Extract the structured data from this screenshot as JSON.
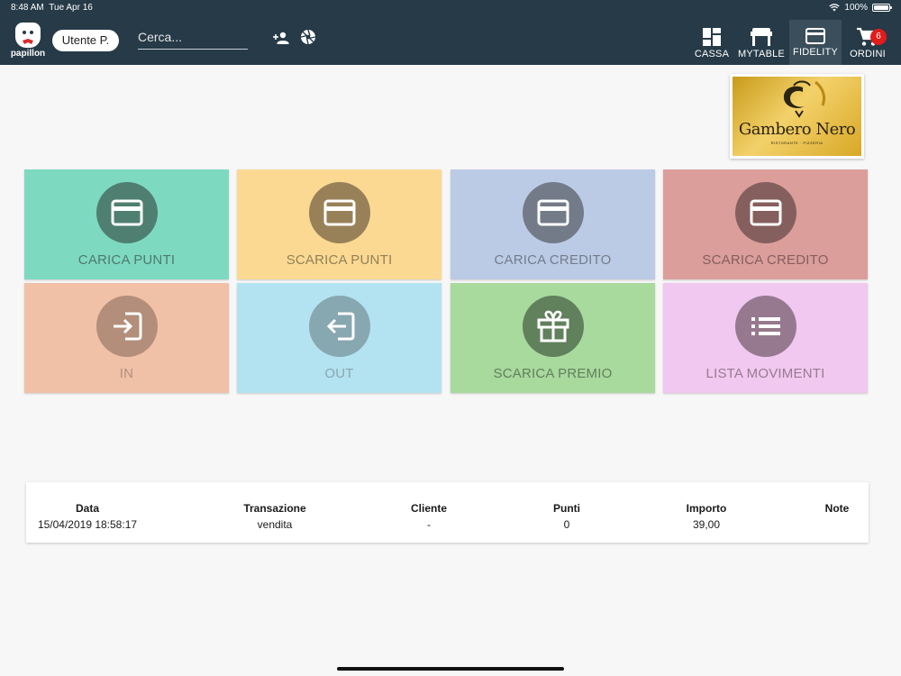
{
  "status_bar": {
    "time": "8:48 AM",
    "date": "Tue Apr 16",
    "battery": "100%",
    "battery_level": 1.0,
    "icons": [
      "wifi-icon",
      "battery-icon"
    ]
  },
  "header": {
    "logo_text": "papillon",
    "user": "Utente P.",
    "search_placeholder": "Cerca...",
    "icons": [
      "add-person-icon",
      "aperture-icon"
    ],
    "nav": [
      {
        "label": "CASSA",
        "icon": "dashboard-icon",
        "active": false
      },
      {
        "label": "MYTABLE",
        "icon": "table-icon",
        "active": false
      },
      {
        "label": "FIDELITY",
        "icon": "card-icon",
        "active": true
      },
      {
        "label": "ORDINI",
        "icon": "cart-icon",
        "active": false,
        "badge": "6"
      }
    ],
    "colors": {
      "background": "#263a47",
      "active": "#3a4e5b",
      "badge": "#e21b1b"
    }
  },
  "brand": {
    "name": "Gambero Nero",
    "subtitle": "RISTORANTE · PIZZERIA"
  },
  "tiles": [
    {
      "label": "CARICA PUNTI",
      "icon": "card-icon",
      "bg": "#7ed9c1",
      "circle": "#4f7f70",
      "text": "#4e7a6d"
    },
    {
      "label": "SCARICA PUNTI",
      "icon": "card-icon",
      "bg": "#fbd993",
      "circle": "#988159",
      "text": "#938058"
    },
    {
      "label": "CARICA CREDITO",
      "icon": "card-icon",
      "bg": "#bccbe5",
      "circle": "#737b89",
      "text": "#747c8b"
    },
    {
      "label": "SCARICA CREDITO",
      "icon": "card-icon",
      "bg": "#db9e9b",
      "circle": "#855f5e",
      "text": "#855f5e"
    },
    {
      "label": "IN",
      "icon": "login-icon",
      "bg": "#f0c1a7",
      "circle": "#b38e7b",
      "text": "#b1907f"
    },
    {
      "label": "OUT",
      "icon": "logout-icon",
      "bg": "#b3e2f0",
      "circle": "#87a7b1",
      "text": "#8aa7b0"
    },
    {
      "label": "SCARICA PREMIO",
      "icon": "gift-icon",
      "bg": "#a8d99d",
      "circle": "#61805c",
      "text": "#61805c"
    },
    {
      "label": "LISTA MOVIMENTI",
      "icon": "list-icon",
      "bg": "#f1c8ef",
      "circle": "#96798f",
      "text": "#977b93"
    }
  ],
  "table": {
    "columns": [
      "Data",
      "Transazione",
      "Cliente",
      "Punti",
      "Importo",
      "Note"
    ],
    "rows": [
      [
        "15/04/2019 18:58:17",
        "vendita",
        "-",
        "0",
        "39,00",
        ""
      ]
    ]
  }
}
